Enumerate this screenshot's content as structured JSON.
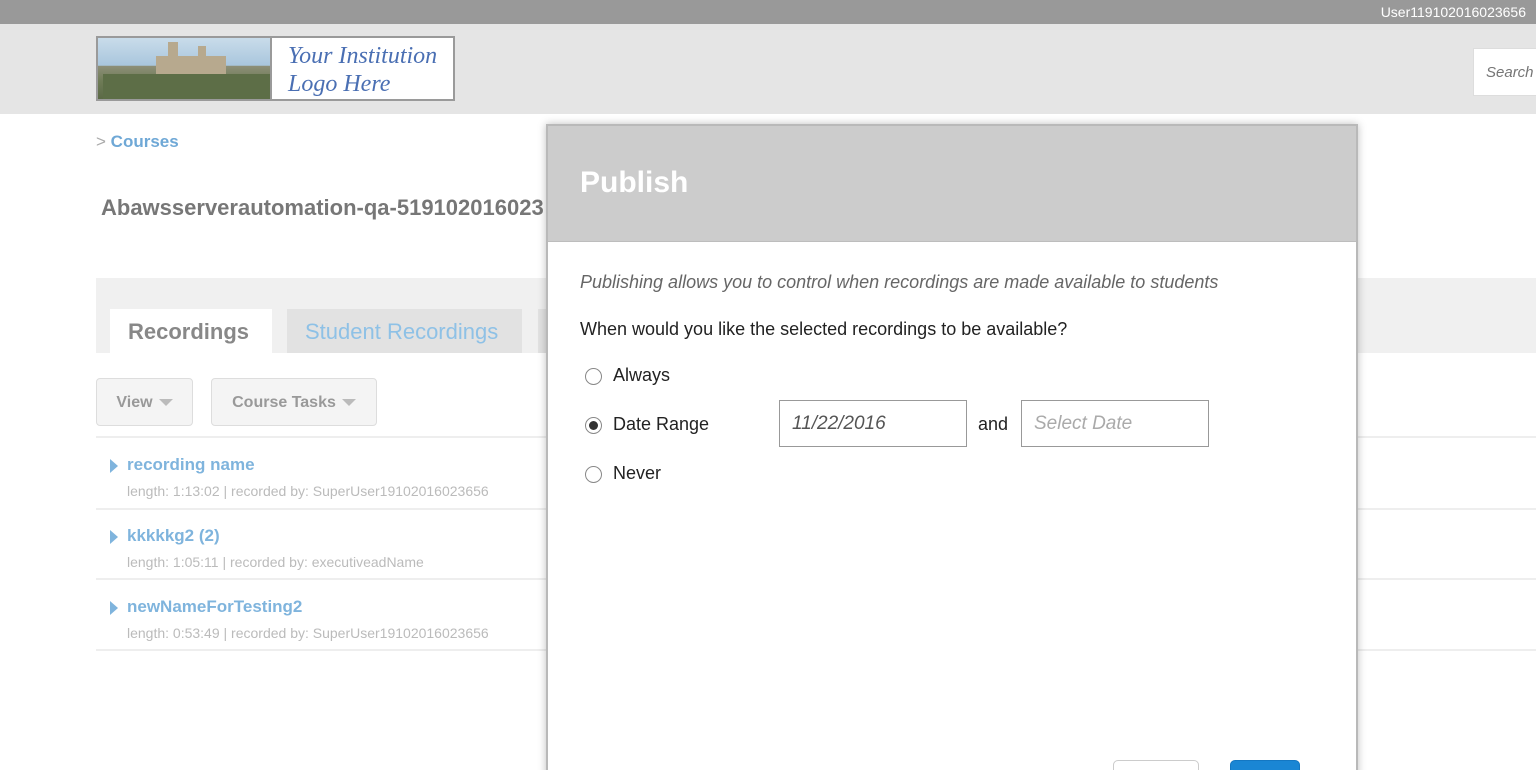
{
  "topbar": {
    "user": "User119102016023656"
  },
  "header": {
    "logo_line1": "Your Institution",
    "logo_line2": "Logo Here",
    "search_placeholder": "Search"
  },
  "breadcrumb": {
    "sep": ">",
    "courses": "Courses"
  },
  "course": {
    "title": "Abawsserverautomation-qa-519102016023"
  },
  "tabs": [
    {
      "label": "Recordings"
    },
    {
      "label": "Student Recordings"
    }
  ],
  "toolbar": {
    "view": "View",
    "course_tasks": "Course Tasks"
  },
  "recordings": [
    {
      "name": "recording name",
      "meta": "length: 1:13:02 | recorded by: SuperUser19102016023656"
    },
    {
      "name": "kkkkkg2 (2)",
      "meta": "length: 1:05:11 | recorded by: executiveadName"
    },
    {
      "name": "newNameForTesting2",
      "meta": "length: 0:53:49 | recorded by: SuperUser19102016023656"
    }
  ],
  "modal": {
    "title": "Publish",
    "intro": "Publishing allows you to control when recordings are made available to students",
    "question": "When would you like the selected recordings to be available?",
    "options": [
      "Always",
      "Date Range",
      "Never"
    ],
    "selected_option": "Date Range",
    "date_from": "11/22/2016",
    "and": "and",
    "date_to_placeholder": "Select Date"
  },
  "colors": {
    "accent": "#1a86d4",
    "link": "#7fb4dd",
    "header_bg": "#e5e5e5",
    "modal_head": "#cccccc"
  }
}
